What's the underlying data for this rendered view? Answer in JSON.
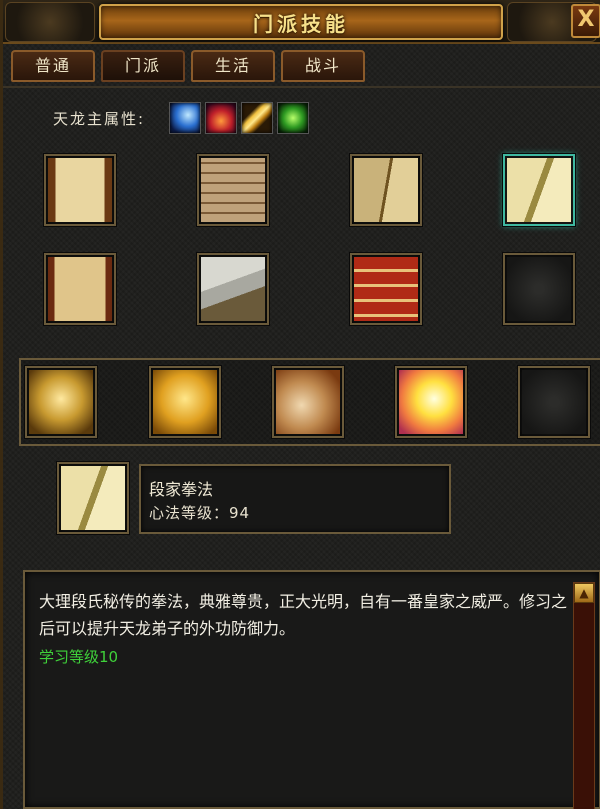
{
  "window": {
    "title": "门派技能",
    "close_label": "X"
  },
  "tabs": [
    {
      "label": "普通"
    },
    {
      "label": "门派"
    },
    {
      "label": "生活"
    },
    {
      "label": "战斗"
    }
  ],
  "attributes": {
    "label": "天龙主属性:",
    "icons": [
      "ice-attribute-icon",
      "fire-attribute-icon",
      "lightning-attribute-icon",
      "poison-attribute-icon"
    ]
  },
  "manuals": [
    {
      "icon": "scroll-open-icon"
    },
    {
      "icon": "scroll-bundle-icon"
    },
    {
      "icon": "open-book-icon"
    },
    {
      "icon": "green-book-icon",
      "selected": true
    },
    {
      "icon": "figure-scroll-icon"
    },
    {
      "icon": "manual-book-icon"
    },
    {
      "icon": "red-books-icon"
    },
    {
      "icon": "empty-slot-icon"
    }
  ],
  "skills": [
    {
      "icon": "golden-armor-icon"
    },
    {
      "icon": "golden-fist-icon"
    },
    {
      "icon": "palm-icon"
    },
    {
      "icon": "sun-burst-icon"
    },
    {
      "icon": "empty-slot-icon"
    }
  ],
  "selected": {
    "name": "段家拳法",
    "level_text": "心法等级：94"
  },
  "description": {
    "text": "大理段氏秘传的拳法，典雅尊贵，正大光明，自有一番皇家之威严。修习之后可以提升天龙弟子的外功防御力。",
    "requirement": "学习等级10"
  },
  "colors": {
    "requirement": "#3fd23a",
    "selected_border": "#3fb8a0",
    "title": "#f7e08a"
  }
}
